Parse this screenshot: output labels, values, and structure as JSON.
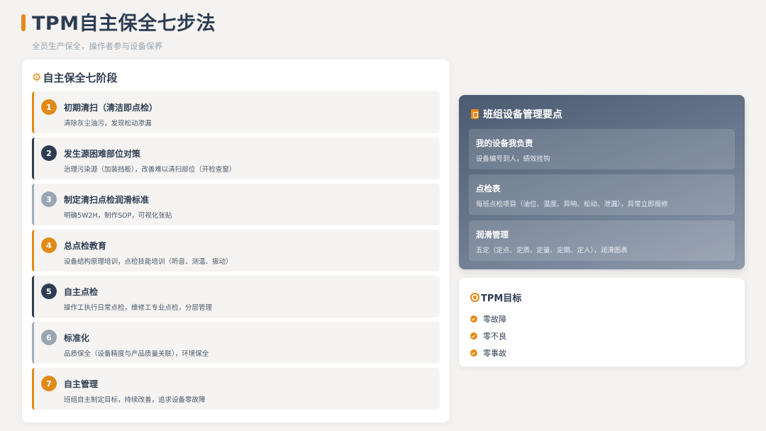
{
  "header": {
    "title": "TPM自主保全七步法",
    "subtitle": "全员生产保全，操作者参与设备保养"
  },
  "stages_panel": {
    "title": "自主保全七阶段",
    "icon": "gears-icon",
    "steps": [
      {
        "num": "1",
        "title": "初期清扫（清洁即点检）",
        "desc": "清除灰尘油污，发现松动渗漏",
        "color": "#e28a17"
      },
      {
        "num": "2",
        "title": "发生源困难部位对策",
        "desc": "治理污染源（加装挡板），改善难以清扫部位（开检查窗）",
        "color": "#2e3d52"
      },
      {
        "num": "3",
        "title": "制定清扫点检润滑标准",
        "desc": "明确5W2H，制作SOP，可视化张贴",
        "color": "#9aa5b4"
      },
      {
        "num": "4",
        "title": "总点检教育",
        "desc": "设备结构原理培训，点检技能培训（听音、测温、振动）",
        "color": "#e28a17"
      },
      {
        "num": "5",
        "title": "自主点检",
        "desc": "操作工执行日常点检，维修工专业点检，分层管理",
        "color": "#2e3d52"
      },
      {
        "num": "6",
        "title": "标准化",
        "desc": "品质保全（设备精度与产品质量关联），环境保全",
        "color": "#9aa5b4"
      },
      {
        "num": "7",
        "title": "自主管理",
        "desc": "班组自主制定目标，持续改善，追求设备零故障",
        "color": "#e28a17"
      }
    ]
  },
  "management_panel": {
    "title": "班组设备管理要点",
    "icon": "clipboard-icon",
    "items": [
      {
        "title": "我的设备我负责",
        "desc": "设备编号到人，绩效挂钩"
      },
      {
        "title": "点检表",
        "desc": "每班点检项目（油位、温度、异响、松动、泄漏），异常立即报修"
      },
      {
        "title": "润滑管理",
        "desc": "五定（定点、定质、定量、定期、定人），润滑图表"
      }
    ]
  },
  "goals_panel": {
    "title": "TPM目标",
    "icon": "target-icon",
    "items": [
      "零故障",
      "零不良",
      "零事故"
    ]
  },
  "colors": {
    "accent": "#e28a17",
    "navy": "#2e3d52",
    "gray": "#9aa5b4",
    "background": "#f4f3f1"
  }
}
